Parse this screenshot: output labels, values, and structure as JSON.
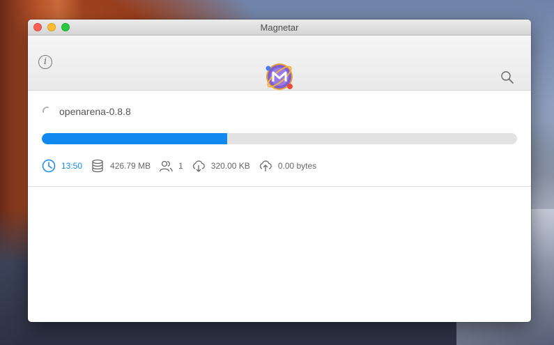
{
  "window": {
    "title": "Magnetar"
  },
  "toolbar": {
    "info_glyph": "i"
  },
  "download": {
    "name": "openarena-0.8.8",
    "progress_fraction": 0.39,
    "eta": "13:50",
    "size": "426.79 MB",
    "peers": "1",
    "download_speed": "320.00 KB",
    "upload_speed": "0.00 bytes"
  },
  "colors": {
    "accent": "#1188f0",
    "track": "#e2e2e2"
  },
  "icons": [
    "info-icon",
    "magnetar-logo",
    "search-icon",
    "spinner-icon",
    "clock-icon",
    "database-icon",
    "peers-icon",
    "cloud-download-icon",
    "cloud-upload-icon"
  ]
}
